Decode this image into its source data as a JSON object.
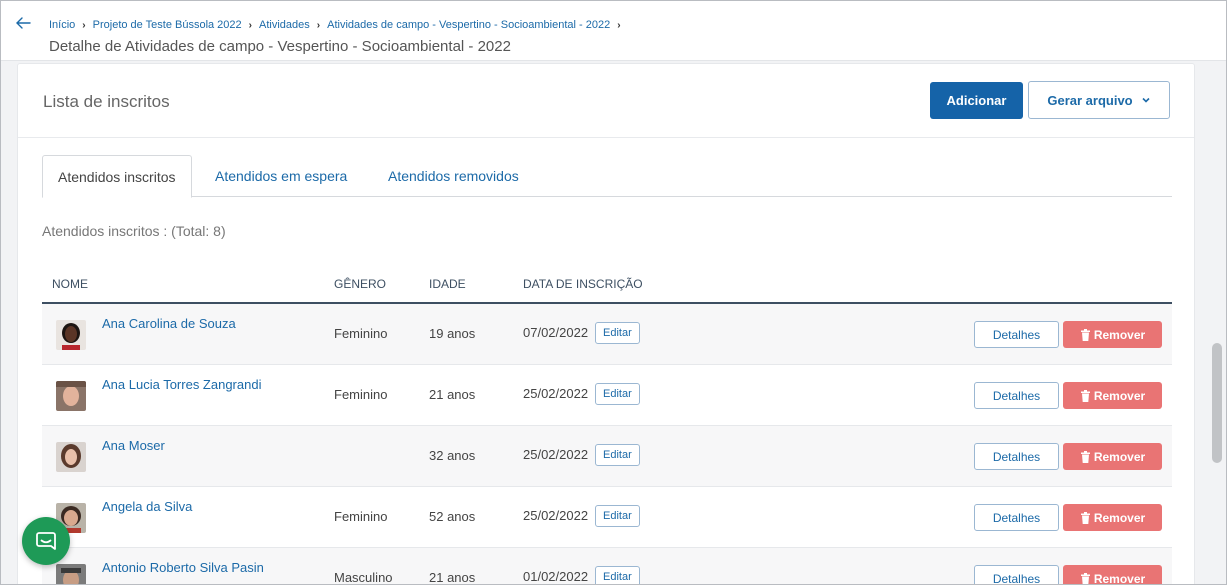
{
  "breadcrumb": {
    "items": [
      "Início",
      "Projeto de Teste Bússola 2022",
      "Atividades",
      "Atividades de campo - Vespertino - Socioambiental - 2022"
    ]
  },
  "page_title": "Detalhe de Atividades de campo - Vespertino - Socioambiental - 2022",
  "card": {
    "title": "Lista de inscritos",
    "add_label": "Adicionar",
    "export_label": "Gerar arquivo"
  },
  "tabs": [
    {
      "label": "Atendidos inscritos",
      "active": true
    },
    {
      "label": "Atendidos em espera",
      "active": false
    },
    {
      "label": "Atendidos removidos",
      "active": false
    }
  ],
  "total_text": "Atendidos inscritos : (Total: 8)",
  "table": {
    "columns": [
      "NOME",
      "GÊNERO",
      "IDADE",
      "DATA DE INSCRIÇÃO"
    ],
    "edit_label": "Editar",
    "details_label": "Detalhes",
    "remove_label": "Remover",
    "rows": [
      {
        "name": "Ana Carolina de Souza",
        "gender": "Feminino",
        "age": "19 anos",
        "date": "07/02/2022"
      },
      {
        "name": "Ana Lucia Torres Zangrandi",
        "gender": "Feminino",
        "age": "21 anos",
        "date": "25/02/2022"
      },
      {
        "name": "Ana Moser",
        "gender": "",
        "age": "32 anos",
        "date": "25/02/2022"
      },
      {
        "name": "Angela da Silva",
        "gender": "Feminino",
        "age": "52 anos",
        "date": "25/02/2022"
      },
      {
        "name": "Antonio Roberto Silva Pasin",
        "gender": "Masculino",
        "age": "21 anos",
        "date": "01/02/2022"
      }
    ]
  },
  "colors": {
    "primary": "#1563a8",
    "link": "#1c6aa8",
    "danger": "#e97474",
    "chat": "#1e9a57"
  },
  "icons": [
    "back-arrow-icon",
    "chevron-right-icon",
    "chevron-down-icon",
    "trash-icon",
    "chat-icon"
  ]
}
